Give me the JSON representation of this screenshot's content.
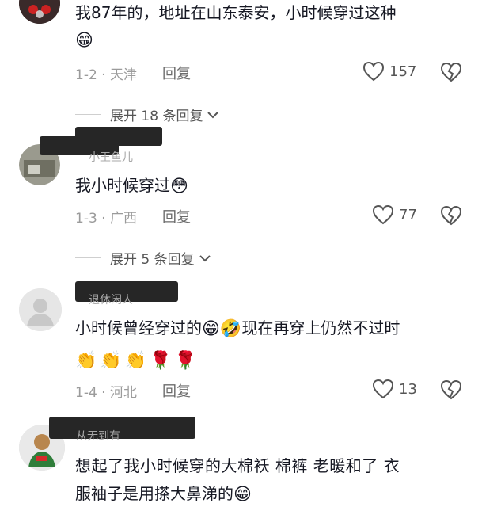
{
  "comments": [
    {
      "text_line1": "我87年的，地址在山东泰安，小时候穿过这种",
      "emoji_line2": "😁",
      "meta": "1-2 · 天津",
      "reply_label": "回复",
      "likes": "157"
    },
    {
      "username": "小王鱼儿",
      "text": "我小时候穿过",
      "emoji": "😳",
      "meta": "1-3 · 广西",
      "reply_label": "回复",
      "likes": "77"
    },
    {
      "username": "退休闲人",
      "text_part1": "小时候曾经穿过的",
      "emoji_part1": "😁🤣",
      "text_part2": "现在再穿上仍然不过时",
      "emoji_line2": "👏👏👏🌹🌹",
      "meta": "1-4 · 河北",
      "reply_label": "回复",
      "likes": "13"
    },
    {
      "username": "从无到有",
      "text_line1": "想起了我小时候穿的大棉袄  棉裤  老暖和了  衣",
      "text_line2": "服袖子是用搽大鼻涕的",
      "emoji_line2": "😁"
    }
  ],
  "expands": [
    {
      "label": "展开 18 条回复"
    },
    {
      "label": "展开 5 条回复"
    }
  ],
  "colors": {
    "text": "#161823",
    "meta": "#9b9b9b",
    "username_redaction": "#262626",
    "divider": "#cfcfcf"
  },
  "icons": [
    "heart-icon",
    "broken-heart-icon",
    "chevron-down-icon"
  ]
}
